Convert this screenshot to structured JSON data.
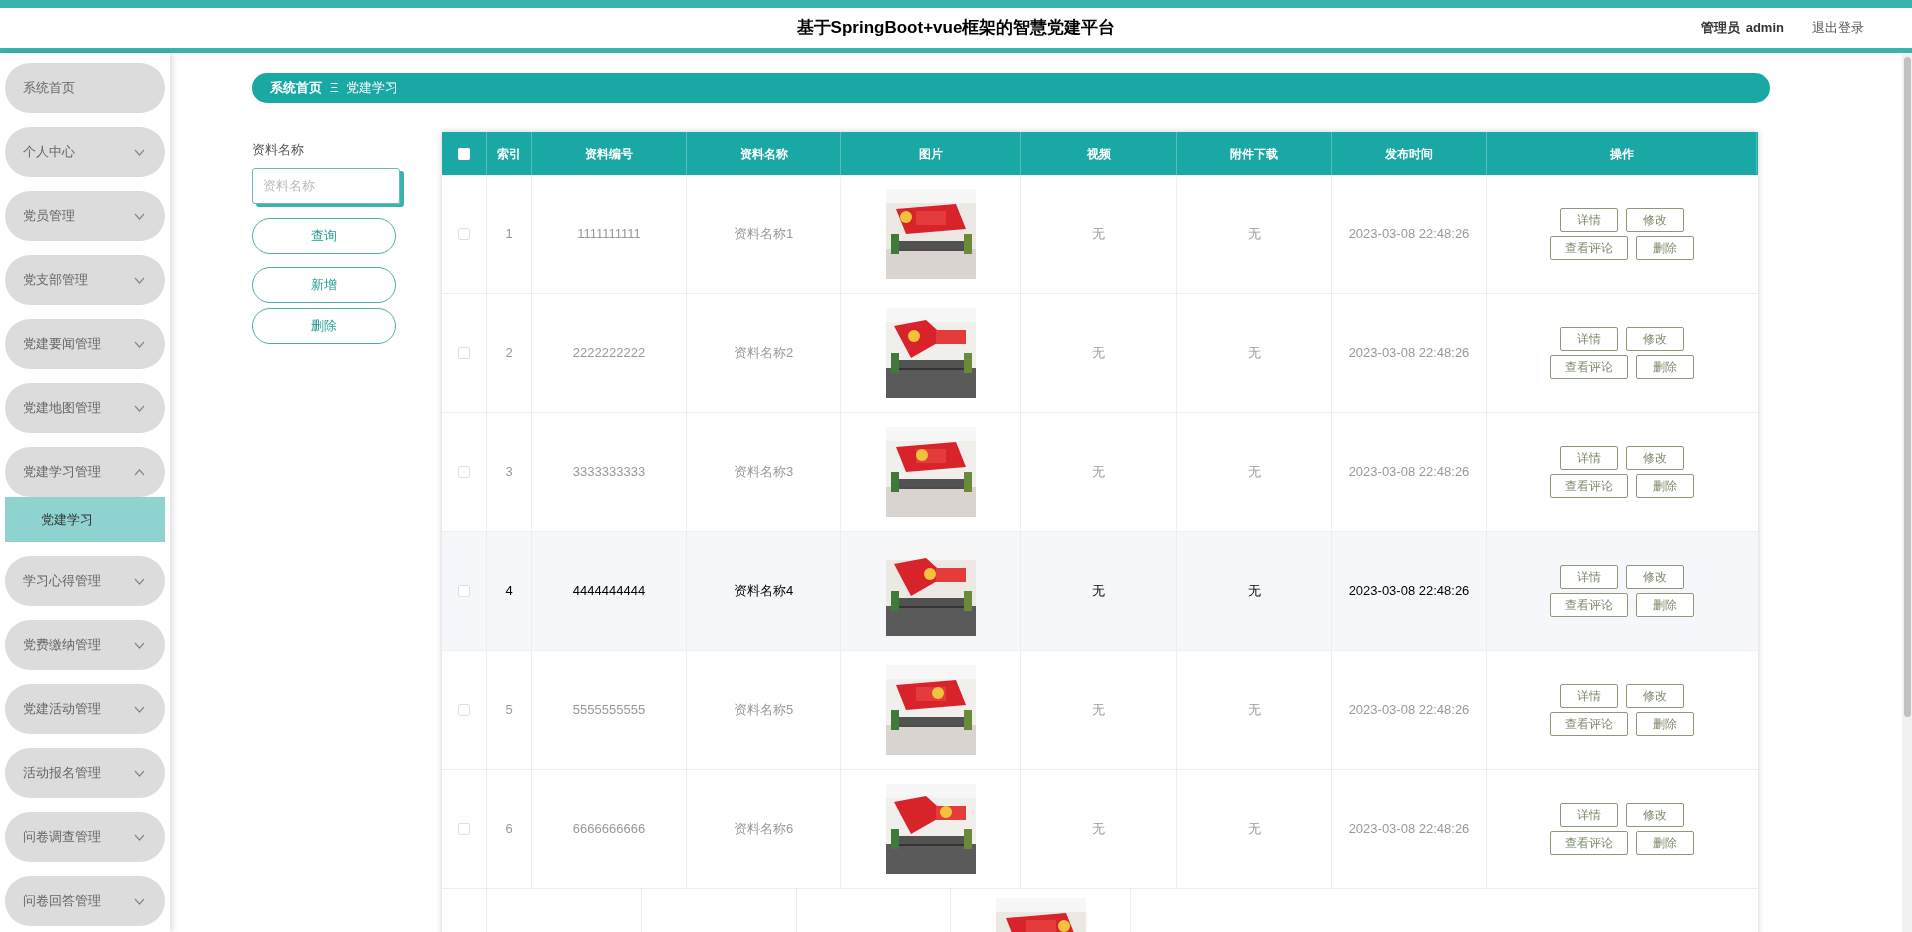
{
  "header": {
    "title": "基于SpringBoot+vue框架的智慧党建平台",
    "user_role": "管理员",
    "user_name": "admin",
    "logout": "退出登录"
  },
  "sidebar": {
    "items": [
      {
        "label": "系统首页",
        "kind": "link"
      },
      {
        "label": "个人中心",
        "kind": "menu",
        "expanded": false
      },
      {
        "label": "党员管理",
        "kind": "menu",
        "expanded": false
      },
      {
        "label": "党支部管理",
        "kind": "menu",
        "expanded": false
      },
      {
        "label": "党建要闻管理",
        "kind": "menu",
        "expanded": false
      },
      {
        "label": "党建地图管理",
        "kind": "menu",
        "expanded": false
      },
      {
        "label": "党建学习管理",
        "kind": "menu",
        "expanded": true,
        "children": [
          {
            "label": "党建学习",
            "selected": true
          }
        ]
      },
      {
        "label": "学习心得管理",
        "kind": "menu",
        "expanded": false
      },
      {
        "label": "党费缴纳管理",
        "kind": "menu",
        "expanded": false
      },
      {
        "label": "党建活动管理",
        "kind": "menu",
        "expanded": false
      },
      {
        "label": "活动报名管理",
        "kind": "menu",
        "expanded": false
      },
      {
        "label": "问卷调查管理",
        "kind": "menu",
        "expanded": false
      },
      {
        "label": "问卷回答管理",
        "kind": "menu",
        "expanded": false
      }
    ]
  },
  "breadcrumb": {
    "home": "系统首页",
    "separator": "Ξ",
    "current": "党建学习"
  },
  "search": {
    "label": "资料名称",
    "placeholder": "资料名称",
    "buttons": [
      "查询",
      "新增",
      "删除"
    ]
  },
  "table": {
    "select_all_checked": false,
    "columns": [
      "索引",
      "资料编号",
      "资料名称",
      "图片",
      "视频",
      "附件下载",
      "发布时间",
      "操作"
    ],
    "rows": [
      {
        "checked": false,
        "highlighted": false,
        "index": "1",
        "code": "1111111111",
        "name": "资料名称1",
        "video": "无",
        "attachment": "无",
        "time": "2023-03-08 22:48:26",
        "actions": [
          "详情",
          "修改",
          "查看评论",
          "删除"
        ]
      },
      {
        "checked": false,
        "highlighted": false,
        "index": "2",
        "code": "2222222222",
        "name": "资料名称2",
        "video": "无",
        "attachment": "无",
        "time": "2023-03-08 22:48:26",
        "actions": [
          "详情",
          "修改",
          "查看评论",
          "删除"
        ]
      },
      {
        "checked": false,
        "highlighted": false,
        "index": "3",
        "code": "3333333333",
        "name": "资料名称3",
        "video": "无",
        "attachment": "无",
        "time": "2023-03-08 22:48:26",
        "actions": [
          "详情",
          "修改",
          "查看评论",
          "删除"
        ]
      },
      {
        "checked": false,
        "highlighted": true,
        "index": "4",
        "code": "4444444444",
        "name": "资料名称4",
        "video": "无",
        "attachment": "无",
        "time": "2023-03-08 22:48:26",
        "actions": [
          "详情",
          "修改",
          "查看评论",
          "删除"
        ]
      },
      {
        "checked": false,
        "highlighted": false,
        "index": "5",
        "code": "5555555555",
        "name": "资料名称5",
        "video": "无",
        "attachment": "无",
        "time": "2023-03-08 22:48:26",
        "actions": [
          "详情",
          "修改",
          "查看评论",
          "删除"
        ]
      },
      {
        "checked": false,
        "highlighted": false,
        "index": "6",
        "code": "6666666666",
        "name": "资料名称6",
        "video": "无",
        "attachment": "无",
        "time": "2023-03-08 22:48:26",
        "actions": [
          "详情",
          "修改",
          "查看评论",
          "删除"
        ]
      }
    ]
  }
}
